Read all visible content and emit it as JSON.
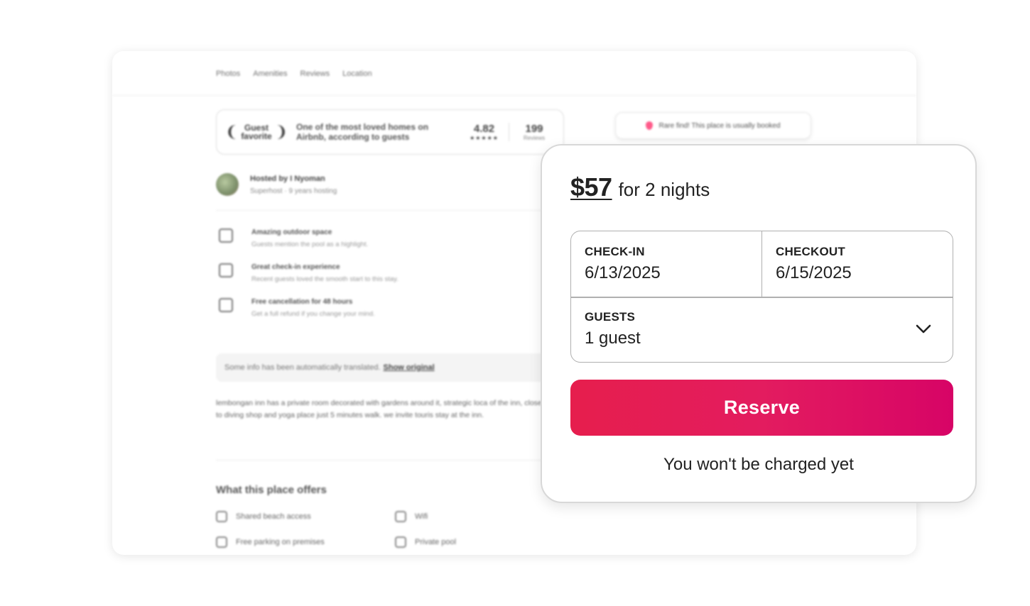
{
  "background_page": {
    "nav": [
      "Photos",
      "Amenities",
      "Reviews",
      "Location"
    ],
    "guest_favorite": {
      "badge_line1": "Guest",
      "badge_line2": "favorite",
      "description": "One of the most loved homes on Airbnb, according to guests",
      "rating": "4.82",
      "stars": "★★★★★",
      "reviews_count": "199",
      "reviews_label": "Reviews"
    },
    "rare_find": "Rare find! This place is usually booked",
    "host": {
      "title": "Hosted by I Nyoman",
      "subtitle": "Superhost · 9 years hosting"
    },
    "highlights": [
      {
        "title": "Amazing outdoor space",
        "subtitle": "Guests mention the pool as a highlight.",
        "icon": "outdoor-icon"
      },
      {
        "title": "Great check-in experience",
        "subtitle": "Recent guests loved the smooth start to this stay.",
        "icon": "key-icon"
      },
      {
        "title": "Free cancellation for 48 hours",
        "subtitle": "Get a full refund if you change your mind.",
        "icon": "calendar-icon"
      }
    ],
    "translation": {
      "text": "Some info has been automatically translated.",
      "link": "Show original"
    },
    "description": "lembongan inn has a private room decorated with gardens around it, strategic loca of the inn, close to diving shop and yoga place just 5 minutes walk. we invite touris stay at the inn.",
    "offers_title": "What this place offers",
    "amenities": [
      {
        "label": "Shared beach access",
        "icon": "beach-icon"
      },
      {
        "label": "Wifi",
        "icon": "wifi-icon"
      },
      {
        "label": "Free parking on premises",
        "icon": "car-icon"
      },
      {
        "label": "Private pool",
        "icon": "pool-icon"
      }
    ]
  },
  "booking": {
    "price": "$57",
    "price_unit": "for 2 nights",
    "checkin_label": "CHECK-IN",
    "checkin_value": "6/13/2025",
    "checkout_label": "CHECKOUT",
    "checkout_value": "6/15/2025",
    "guests_label": "GUESTS",
    "guests_value": "1 guest",
    "reserve_label": "Reserve",
    "note": "You won't be charged yet",
    "accent_colors": [
      "#e61e4d",
      "#d70466"
    ]
  }
}
